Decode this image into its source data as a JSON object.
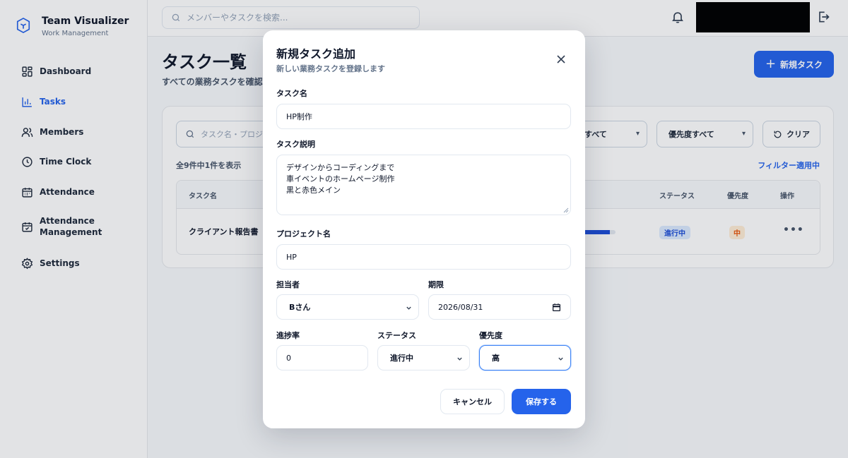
{
  "app": {
    "name": "Team Visualizer",
    "subtitle": "Work Management"
  },
  "sidebar": {
    "items": [
      {
        "label": "Dashboard",
        "icon": "dashboard-icon",
        "active": false
      },
      {
        "label": "Tasks",
        "icon": "chart-icon",
        "active": true
      },
      {
        "label": "Members",
        "icon": "users-icon",
        "active": false
      },
      {
        "label": "Time Clock",
        "icon": "clock-icon",
        "active": false
      },
      {
        "label": "Attendance",
        "icon": "calendar-icon",
        "active": false
      },
      {
        "label": "Attendance\nManagement",
        "icon": "calendar-check-icon",
        "active": false
      },
      {
        "label": "Settings",
        "icon": "gear-icon",
        "active": false
      }
    ]
  },
  "topbar": {
    "search_placeholder": "メンバーやタスクを検索..."
  },
  "page": {
    "title": "タスク一覧",
    "subtitle": "すべての業務タスクを確認・",
    "new_task_label": "新規タスク"
  },
  "filters": {
    "search_placeholder": "タスク名・プロジ",
    "status_select": "すべて",
    "priority_select": "優先度すべて",
    "clear_label": "クリア",
    "count_text": "全9件中1件を表示",
    "active_text": "フィルター適用中"
  },
  "table": {
    "headers": {
      "name": "タスク名",
      "status": "ステータス",
      "priority": "優先度",
      "actions": "操作"
    },
    "rows": [
      {
        "name": "クライアント報告書",
        "progress": 0.85,
        "status": "進行中",
        "priority": "中"
      }
    ]
  },
  "modal": {
    "title": "新規タスク追加",
    "subtitle": "新しい業務タスクを登録します",
    "fields": {
      "task_name": {
        "label": "タスク名",
        "value": "HP制作"
      },
      "description": {
        "label": "タスク説明",
        "value": "デザインからコーディングまで\n車イベントのホームページ制作\n黒と赤色メイン"
      },
      "project": {
        "label": "プロジェクト名",
        "value": "HP"
      },
      "assignee": {
        "label": "担当者",
        "value": "Bさん"
      },
      "deadline": {
        "label": "期限",
        "value": "2026/08/31"
      },
      "progress": {
        "label": "進捗率",
        "value": "0"
      },
      "status": {
        "label": "ステータス",
        "value": "進行中"
      },
      "priority": {
        "label": "優先度",
        "value": "高"
      }
    },
    "cancel_label": "キャンセル",
    "save_label": "保存する"
  },
  "colors": {
    "accent": "#2563eb",
    "status_bg": "#dbeafe",
    "priority_bg": "#ffedd5",
    "priority_text": "#ea580c"
  }
}
